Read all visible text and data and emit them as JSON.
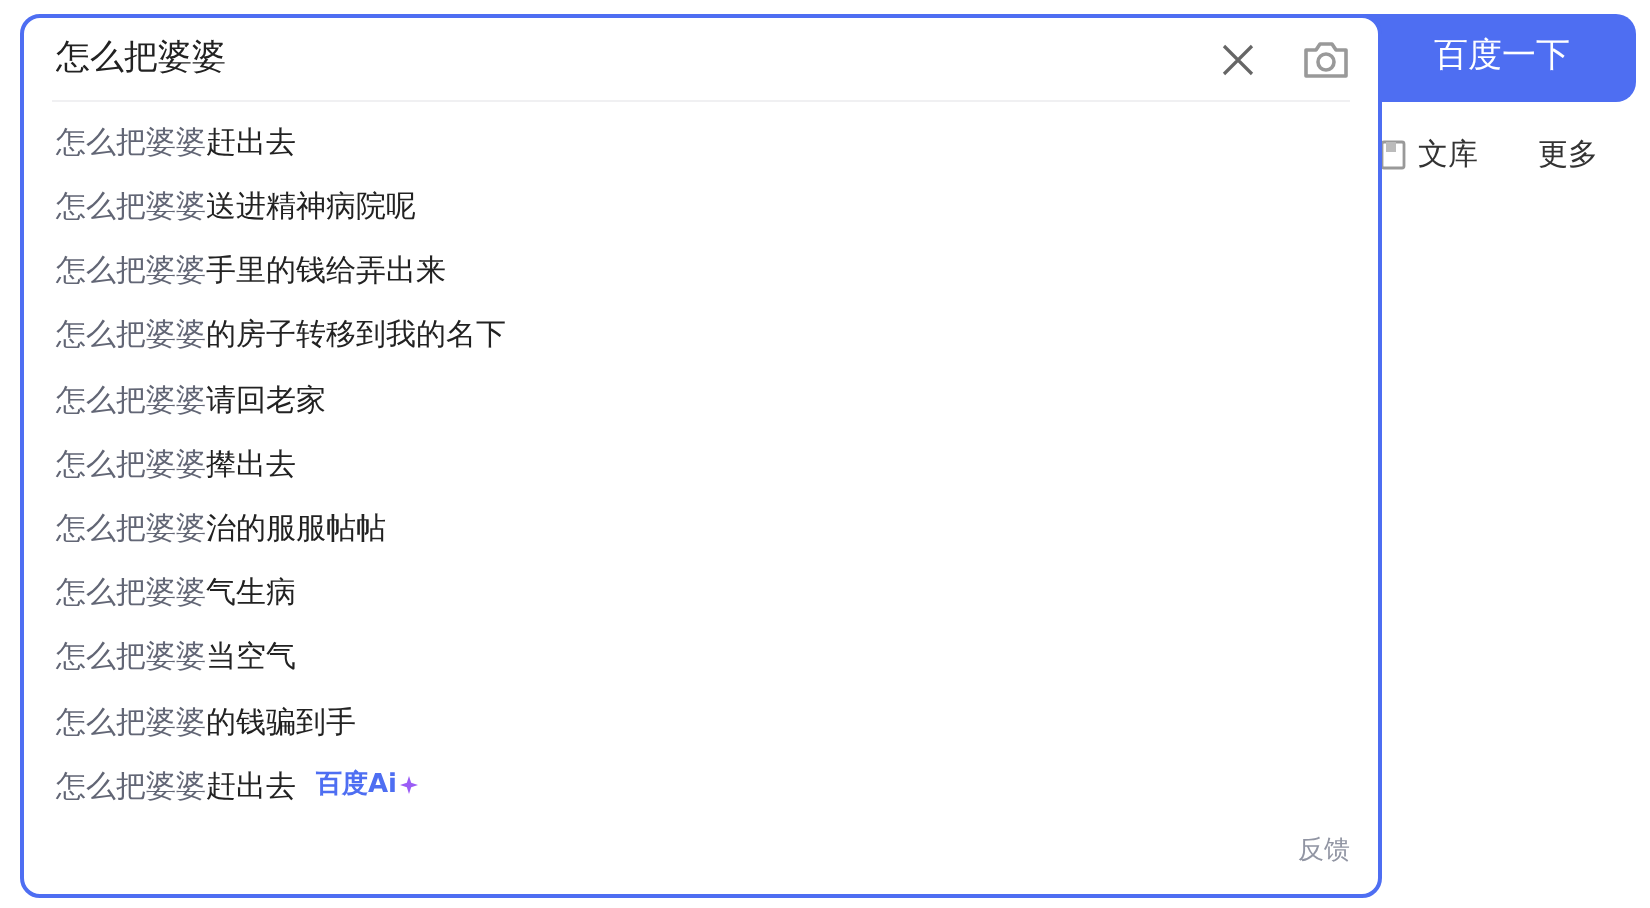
{
  "search": {
    "value": "怎么把婆婆",
    "button": "百度一下"
  },
  "nav_links": [
    {
      "label": "文库",
      "kind": "doc"
    },
    {
      "label": "更多",
      "kind": "plain"
    }
  ],
  "suggestions": [
    {
      "prefix": "怎么把婆婆",
      "rest": "赶出去"
    },
    {
      "prefix": "怎么把婆婆",
      "rest": "送进精神病院呢"
    },
    {
      "prefix": "怎么把婆婆",
      "rest": "手里的钱给弄出来"
    },
    {
      "prefix": "怎么把婆婆",
      "rest": "的房子转移到我的名下"
    },
    {
      "prefix": "怎么把婆婆",
      "rest": "请回老家"
    },
    {
      "prefix": "怎么把婆婆",
      "rest": "撵出去"
    },
    {
      "prefix": "怎么把婆婆",
      "rest": "治的服服帖帖"
    },
    {
      "prefix": "怎么把婆婆",
      "rest": "气生病"
    },
    {
      "prefix": "怎么把婆婆",
      "rest": "当空气"
    },
    {
      "prefix": "怎么把婆婆",
      "rest": "的钱骗到手"
    },
    {
      "prefix": "怎么把婆婆",
      "rest": "赶出去",
      "badge": "百度Ai"
    }
  ],
  "feedback": "反馈"
}
